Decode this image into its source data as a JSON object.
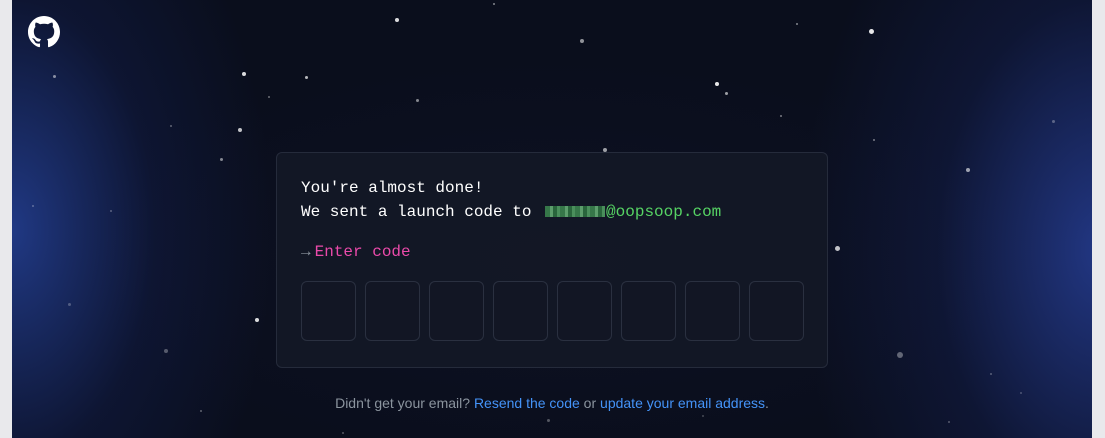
{
  "header": {
    "logo_icon": "github-octocat-icon"
  },
  "card": {
    "line1": "You're almost done!",
    "line2_prefix": "We sent a launch code to ",
    "email_domain": "@oopsoop.com",
    "prompt_arrow": "→",
    "prompt_label": "Enter code",
    "code_digits": [
      "",
      "",
      "",
      "",
      "",
      "",
      "",
      ""
    ]
  },
  "footer": {
    "text_before": "Didn't get your email? ",
    "resend_link": "Resend the code",
    "text_middle": " or ",
    "update_link": "update your email address",
    "text_after": "."
  },
  "colors": {
    "prompt": "#ea4aaa",
    "email": "#56d364",
    "link": "#4493f8",
    "muted": "#8b949e"
  }
}
